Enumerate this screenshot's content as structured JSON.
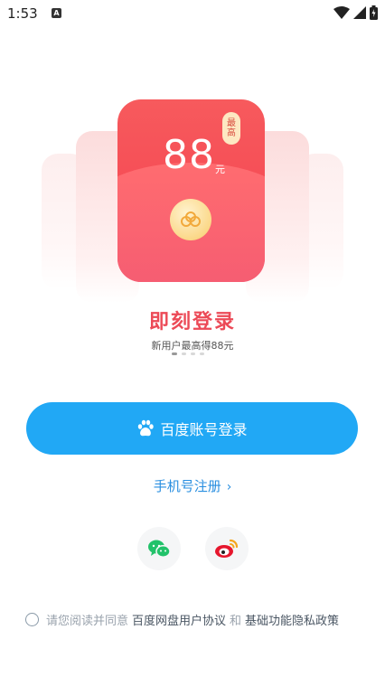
{
  "status_bar": {
    "time": "1:53",
    "notification_badge": "A"
  },
  "hero": {
    "amount": "88",
    "amount_unit": "元",
    "tag_line1": "最",
    "tag_line2": "高",
    "title": "即刻登录",
    "subtitle": "新用户最高得88元",
    "pager": {
      "total": 4,
      "active_index": 0
    }
  },
  "login_button": {
    "label": "百度账号登录",
    "icon": "baidu-paw-icon"
  },
  "register_link": {
    "label": "手机号注册",
    "chevron": "›"
  },
  "social_logins": [
    {
      "name": "wechat",
      "icon": "wechat-icon",
      "color": "#22c26a"
    },
    {
      "name": "weibo",
      "icon": "weibo-icon",
      "color": "#e6162d"
    }
  ],
  "agreement": {
    "prefix": "请您阅读并同意",
    "user_agreement": "百度网盘用户协议",
    "conjunction": "和",
    "privacy_policy": "基础功能隐私政策"
  },
  "colors": {
    "primary": "#21a8f5",
    "link": "#2a8fe0",
    "accent_red": "#ec4a57"
  }
}
